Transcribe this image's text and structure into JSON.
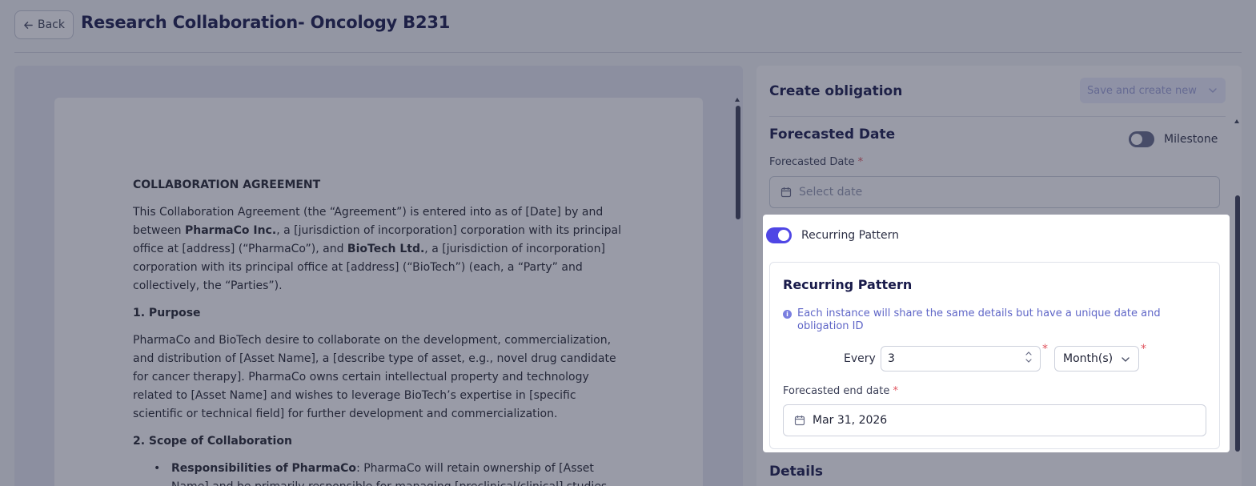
{
  "header": {
    "back_label": "Back",
    "title": "Research Collaboration- Oncology B231"
  },
  "document": {
    "title": "COLLABORATION AGREEMENT",
    "intro": {
      "t1": "This Collaboration Agreement (the “Agreement”) is entered into as of [Date] by and between ",
      "b1": "PharmaCo Inc.",
      "t2": ", a [jurisdiction of incorporation] corporation with its principal office at [address] (“PharmaCo”), and ",
      "b2": "BioTech Ltd.",
      "t3": ", a [jurisdiction of incorporation] corporation with its principal office at [address] (“BioTech”) (each, a “Party” and collectively, the “Parties”)."
    },
    "section1_heading": "1. Purpose",
    "section1_body": "PharmaCo and BioTech desire to collaborate on the development, commercialization, and distribution of [Asset Name], a [describe type of asset, e.g., novel drug candidate for cancer therapy]. PharmaCo owns certain intellectual property and technology related to [Asset Name] and wishes to leverage BioTech’s expertise in [specific scientific or technical field] for further development and commercialization.",
    "section2_heading": "2. Scope of Collaboration",
    "bullet1_bold": "Responsibilities of PharmaCo",
    "bullet1_text": ": PharmaCo will retain ownership of [Asset Name] and be primarily responsible for managing [preclinical/clinical] studies"
  },
  "panel": {
    "title": "Create obligation",
    "save_label": "Save and create new",
    "section_title": "Forecasted Date",
    "milestone_label": "Milestone",
    "milestone_on": false,
    "forecasted_date_label": "Forecasted Date",
    "required_mark": "*",
    "forecasted_date_placeholder": "Select date",
    "details_title": "Details"
  },
  "recurring": {
    "toggle_label": "Recurring Pattern",
    "toggle_on": true,
    "card_title": "Recurring Pattern",
    "info_text": "Each instance will share the same details but have a unique date and obligation ID",
    "every_label": "Every",
    "every_value": "3",
    "unit_value": "Month(s)",
    "end_date_label": "Forecasted end date",
    "end_date_value": "Mar 31, 2026"
  },
  "colors": {
    "accent": "#4f46e5",
    "title_navy": "#181a4a",
    "required_red": "#e0545e",
    "info_blue": "#5f66c7"
  },
  "icons": [
    "arrow-left-icon",
    "chevron-down-icon",
    "calendar-icon",
    "info-icon",
    "chevron-up-icon"
  ]
}
